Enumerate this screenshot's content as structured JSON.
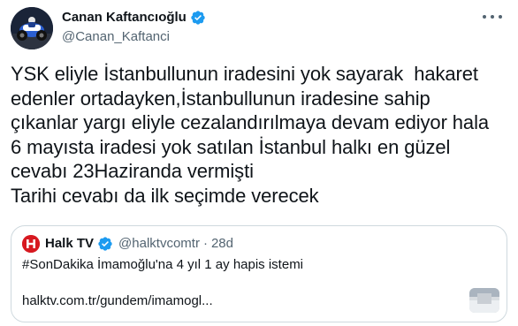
{
  "author": {
    "name": "Canan Kaftancıoğlu",
    "handle": "@Canan_Kaftanci",
    "verified_icon": "verified-badge-icon",
    "verified_color": "#1d9bf0"
  },
  "more_icon": "more-horizontal-icon",
  "tweet": {
    "text": "YSK eliyle İstanbullunun iradesini yok sayarak  hakaret\nedenler ortadayken,İstanbullunun iradesine sahip\nçıkanlar yargı eliyle cezalandırılmaya devam ediyor hala\n6 mayısta iradesi yok satılan İstanbul halkı en güzel\ncevabı 23Haziranda vermişti\nTarihi cevabı da ilk seçimde verecek"
  },
  "quote": {
    "account_name": "Halk TV",
    "handle": "@halktvcomtr",
    "separator": "·",
    "time": "28d",
    "text": "#SonDakika İmamoğlu'na 4 yıl 1 ay hapis istemi",
    "link": "halktv.com.tr/gundem/imamogl...",
    "logo_icon": "halktv-logo-icon",
    "brand_color": "#d71920"
  },
  "colors": {
    "text": "#0f1419",
    "secondary": "#536471",
    "border": "#cfd9de"
  }
}
